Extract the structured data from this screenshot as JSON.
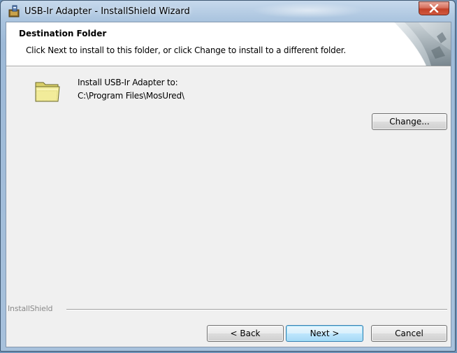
{
  "window": {
    "title": "USB-Ir Adapter - InstallShield Wizard",
    "icon": "installer-icon",
    "close_icon": "close-icon",
    "colors": {
      "frame": "#a9c3de",
      "close": "#c24128",
      "client": "#f0f0f0",
      "banner": "#ffffff"
    }
  },
  "banner": {
    "title": "Destination Folder",
    "subtitle": "Click Next to install to this folder, or click Change to install to a different folder."
  },
  "destination": {
    "icon": "folder-icon",
    "label": "Install USB-Ir Adapter to:",
    "path": "C:\\Program Files\\MosUred\\",
    "change_label": "Change..."
  },
  "footer": {
    "brand": "InstallShield",
    "back_label": "< Back",
    "next_label": "Next >",
    "cancel_label": "Cancel"
  }
}
